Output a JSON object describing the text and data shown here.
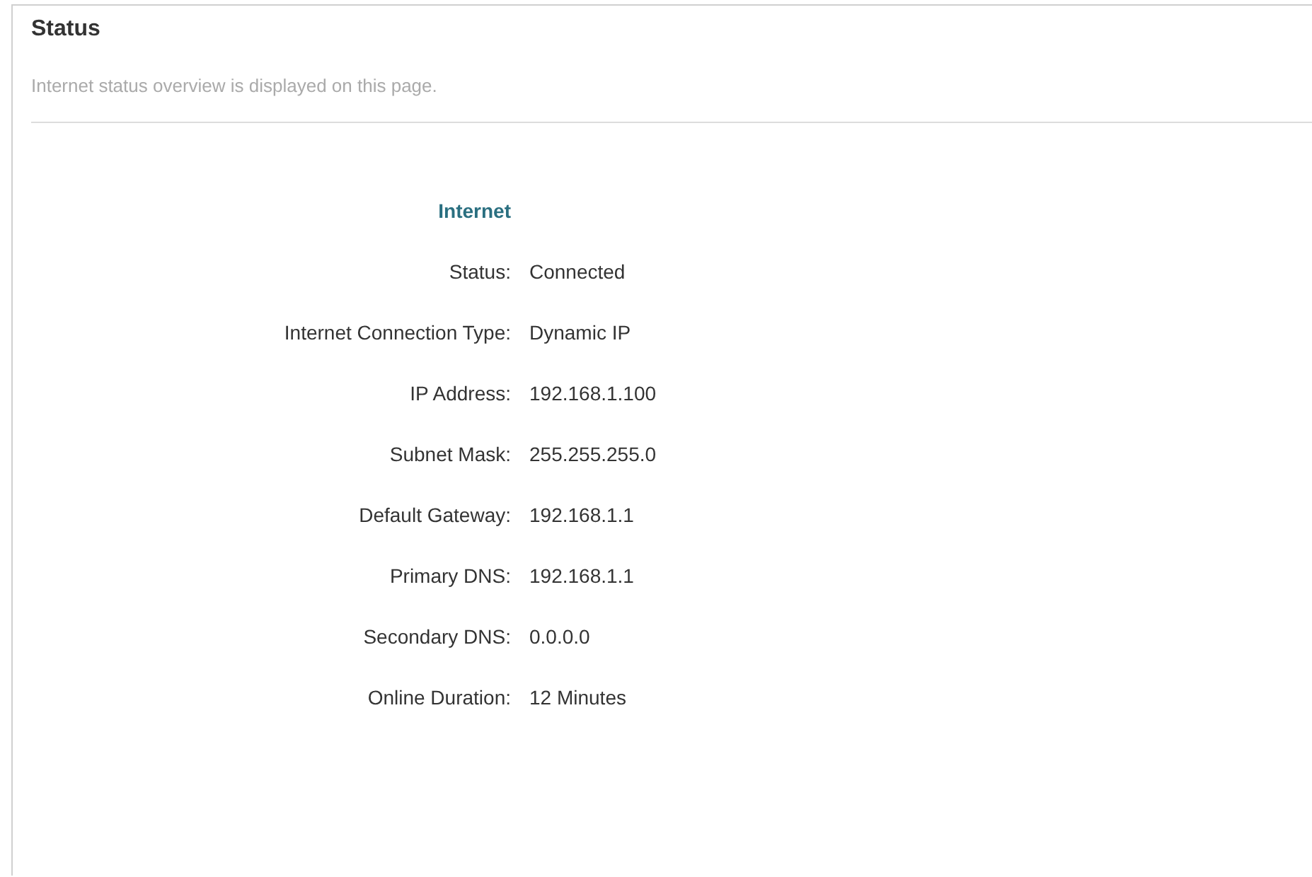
{
  "title": "Status",
  "description": "Internet status overview is displayed on this page.",
  "section": {
    "title": "Internet",
    "rows": [
      {
        "label": "Status:",
        "value": "Connected"
      },
      {
        "label": "Internet Connection Type:",
        "value": "Dynamic IP"
      },
      {
        "label": "IP Address:",
        "value": "192.168.1.100"
      },
      {
        "label": "Subnet Mask:",
        "value": "255.255.255.0"
      },
      {
        "label": "Default Gateway:",
        "value": "192.168.1.1"
      },
      {
        "label": "Primary DNS:",
        "value": "192.168.1.1"
      },
      {
        "label": "Secondary DNS:",
        "value": "0.0.0.0"
      },
      {
        "label": "Online Duration:",
        "value": "12 Minutes"
      }
    ]
  }
}
